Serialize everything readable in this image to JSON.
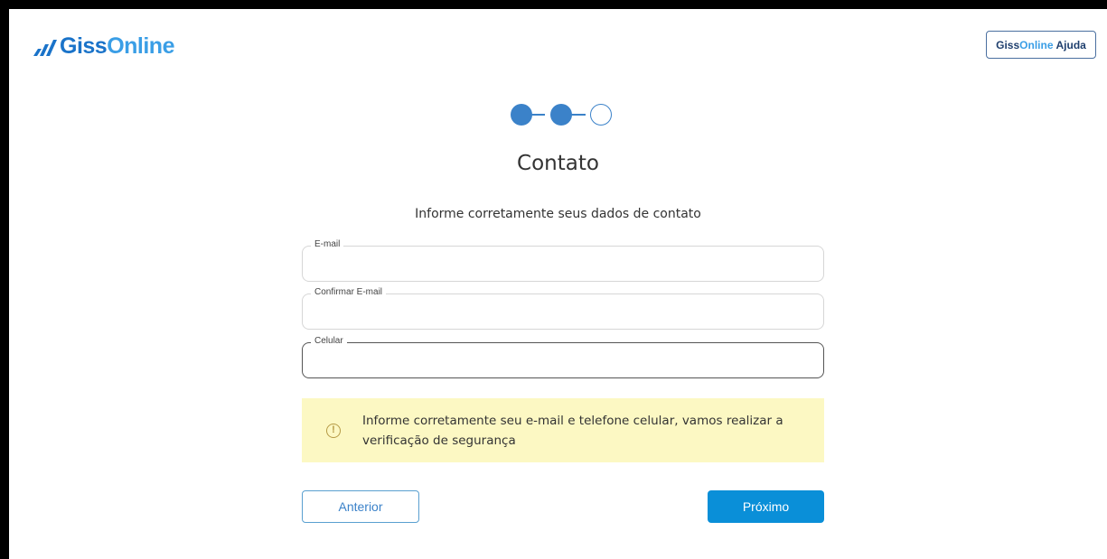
{
  "header": {
    "logo_part1": "Giss",
    "logo_part2": "Online",
    "help_part1": "Giss",
    "help_part2": "Online",
    "help_part3": "Ajuda"
  },
  "stepper": {
    "current_step": 2,
    "total_steps": 3
  },
  "page": {
    "title": "Contato",
    "subtitle": "Informe corretamente seus dados de contato"
  },
  "form": {
    "email_label": "E-mail",
    "email_value": "",
    "confirm_email_label": "Confirmar E-mail",
    "confirm_email_value": "",
    "phone_label": "Celular",
    "phone_value": ""
  },
  "alert": {
    "icon": "exclamation-circle-icon",
    "text": "Informe corretamente seu e-mail e telefone celular, vamos realizar a verificação de segurança"
  },
  "buttons": {
    "previous": "Anterior",
    "next": "Próximo"
  },
  "colors": {
    "primary": "#0a8fd8",
    "step": "#3b82c9",
    "alert_bg": "#fcf8c3"
  }
}
